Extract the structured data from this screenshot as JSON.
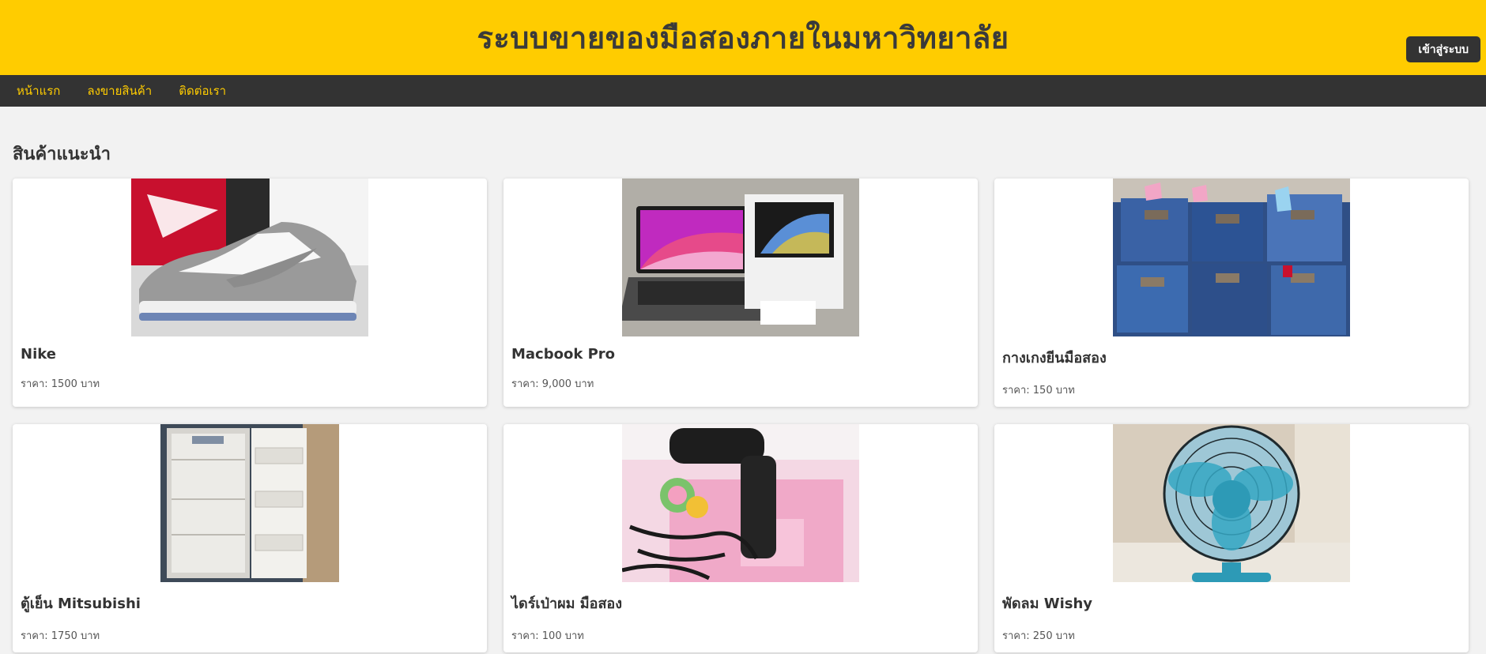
{
  "header": {
    "title": "ระบบขายของมือสองภายในมหาวิทยาลัย",
    "login_label": "เข้าสู่ระบบ"
  },
  "nav": {
    "items": [
      {
        "label": "หน้าแรก"
      },
      {
        "label": "ลงขายสินค้า"
      },
      {
        "label": "ติดต่อเรา"
      }
    ]
  },
  "main": {
    "section_title": "สินค้าแนะนำ",
    "products": [
      {
        "name": "Nike",
        "price": "ราคา: 1500 บาท",
        "image": "sneaker-photo"
      },
      {
        "name": "Macbook Pro",
        "price": "ราคา: 9,000 บาท",
        "image": "laptop-photo"
      },
      {
        "name": "กางเกงยีนมือสอง",
        "price": "ราคา: 150 บาท",
        "image": "jeans-photo"
      },
      {
        "name": "ตู้เย็น Mitsubishi",
        "price": "ราคา: 1750 บาท",
        "image": "fridge-photo"
      },
      {
        "name": "ไดร์เป่าผม มือสอง",
        "price": "ราคา: 100 บาท",
        "image": "hairdryer-photo"
      },
      {
        "name": "พัดลม Wishy",
        "price": "ราคา: 250 บาท",
        "image": "fan-photo"
      }
    ]
  },
  "colors": {
    "header_bg": "#ffcc00",
    "nav_bg": "#333333",
    "nav_link": "#ffcc00",
    "page_bg": "#f2f2f2"
  }
}
